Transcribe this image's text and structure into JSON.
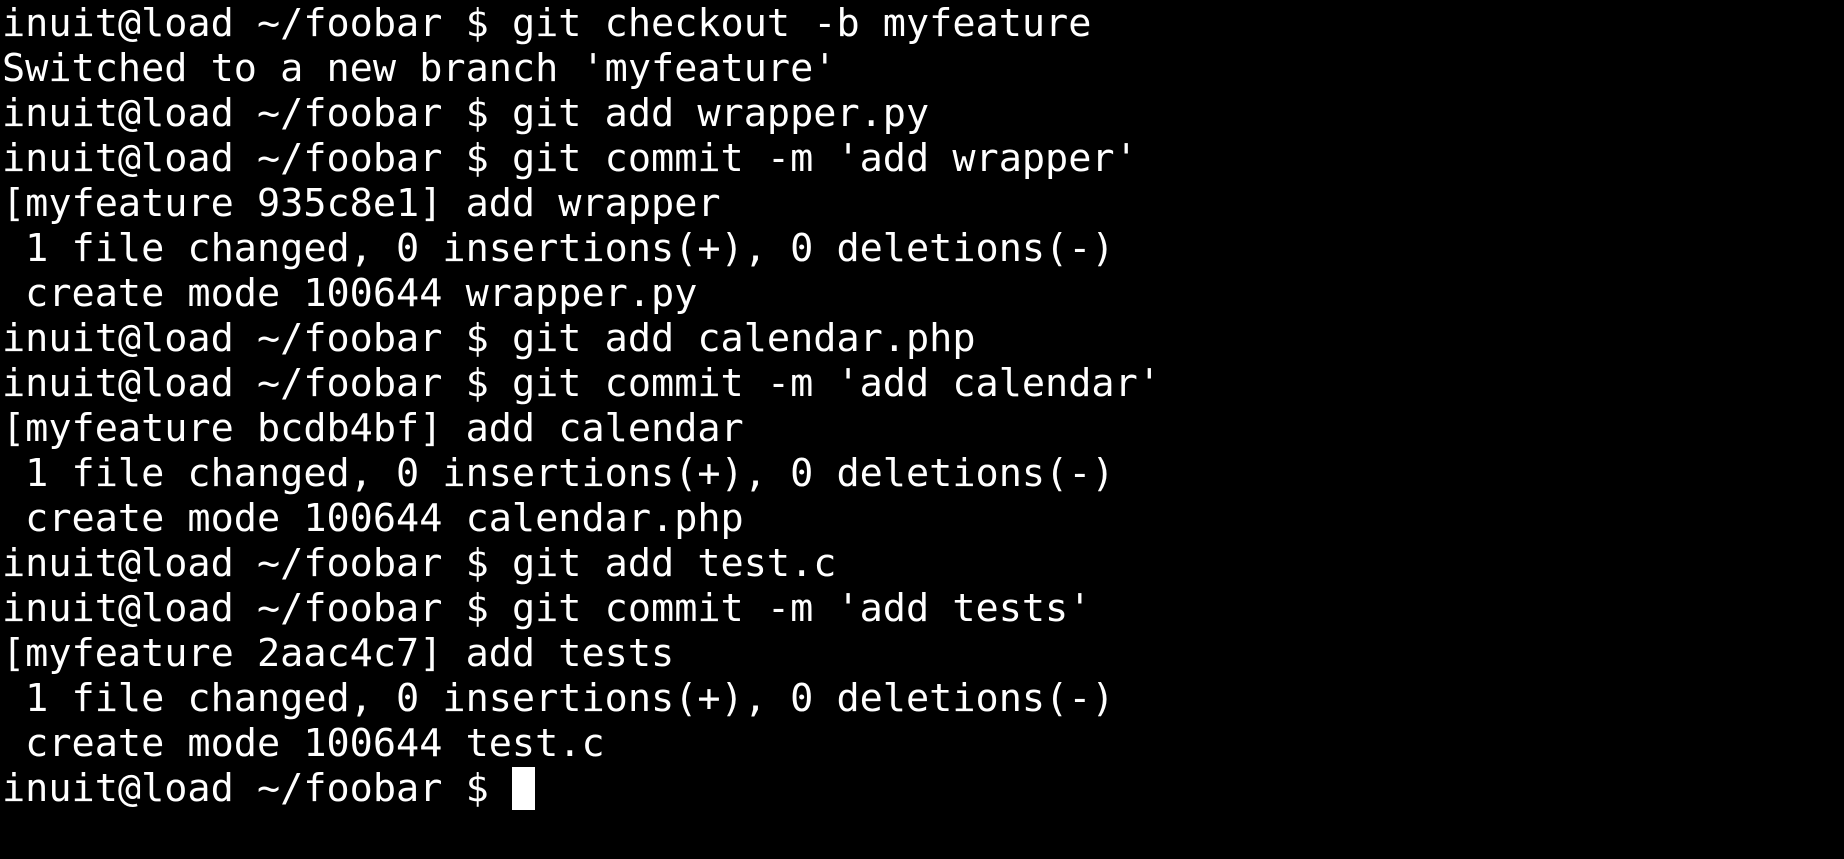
{
  "terminal": {
    "background": "#000000",
    "foreground": "#ffffff",
    "prompt": "inuit@load ~/foobar $ ",
    "lines": [
      {
        "kind": "command",
        "command": "git checkout -b myfeature"
      },
      {
        "kind": "output",
        "text": "Switched to a new branch 'myfeature'"
      },
      {
        "kind": "command",
        "command": "git add wrapper.py"
      },
      {
        "kind": "command",
        "command": "git commit -m 'add wrapper'"
      },
      {
        "kind": "output",
        "text": "[myfeature 935c8e1] add wrapper"
      },
      {
        "kind": "output",
        "text": " 1 file changed, 0 insertions(+), 0 deletions(-)"
      },
      {
        "kind": "output",
        "text": " create mode 100644 wrapper.py"
      },
      {
        "kind": "command",
        "command": "git add calendar.php"
      },
      {
        "kind": "command",
        "command": "git commit -m 'add calendar'"
      },
      {
        "kind": "output",
        "text": "[myfeature bcdb4bf] add calendar"
      },
      {
        "kind": "output",
        "text": " 1 file changed, 0 insertions(+), 0 deletions(-)"
      },
      {
        "kind": "output",
        "text": " create mode 100644 calendar.php"
      },
      {
        "kind": "command",
        "command": "git add test.c"
      },
      {
        "kind": "command",
        "command": "git commit -m 'add tests'"
      },
      {
        "kind": "output",
        "text": "[myfeature 2aac4c7] add tests"
      },
      {
        "kind": "output",
        "text": " 1 file changed, 0 insertions(+), 0 deletions(-)"
      },
      {
        "kind": "output",
        "text": " create mode 100644 test.c"
      },
      {
        "kind": "input",
        "command": ""
      }
    ]
  }
}
